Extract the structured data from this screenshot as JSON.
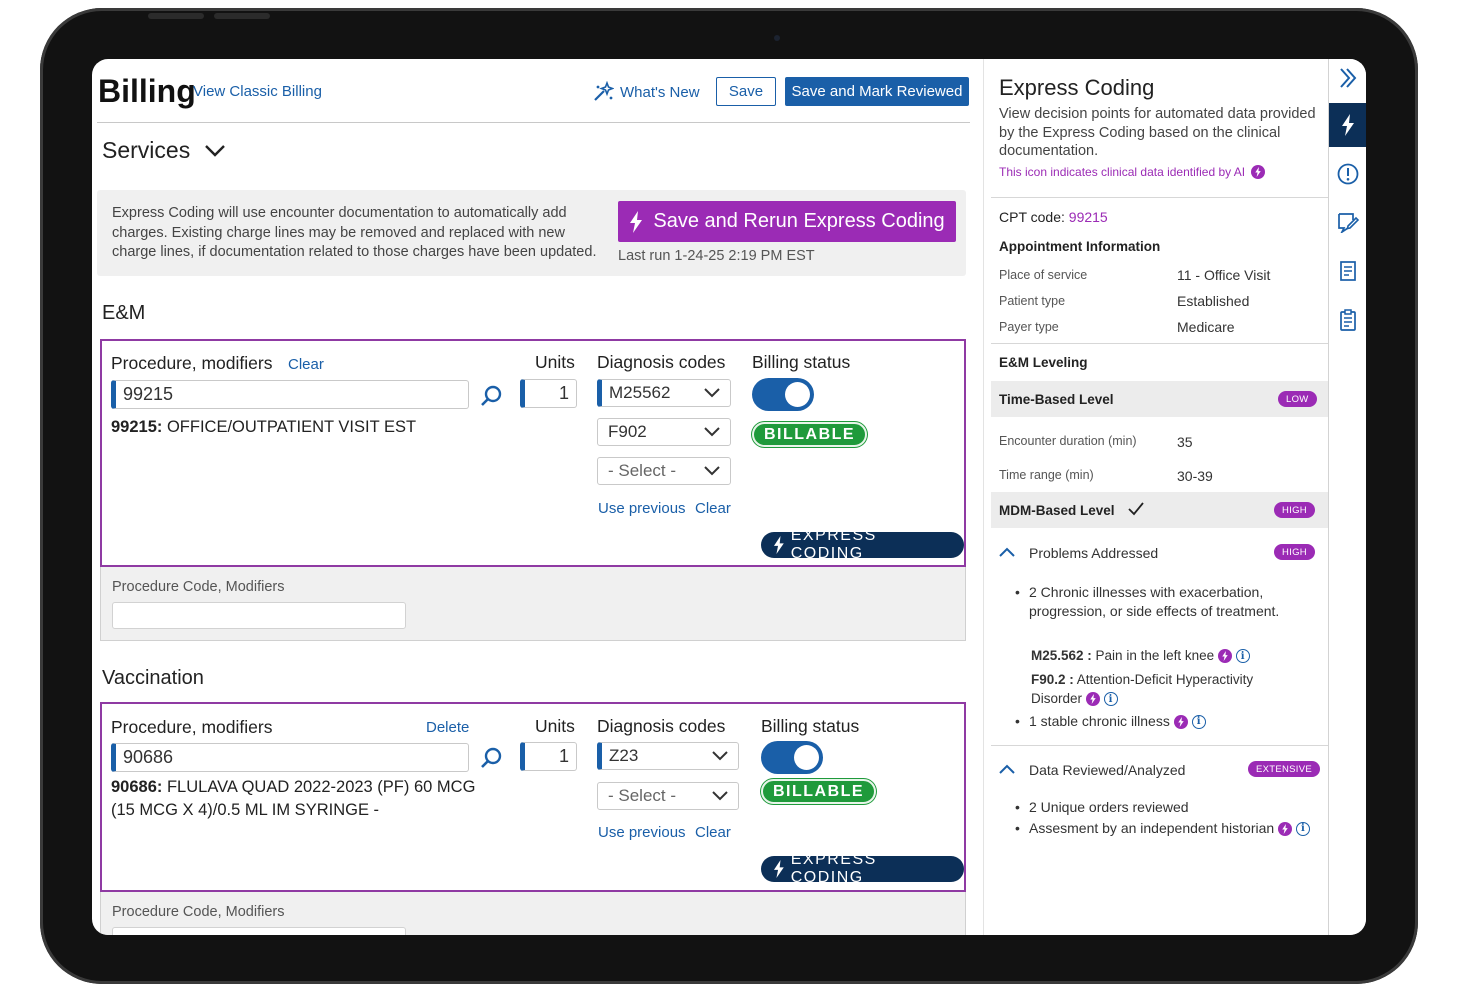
{
  "header": {
    "title": "Billing",
    "classic_link": "View Classic Billing",
    "whats_new": "What's New",
    "save": "Save",
    "save_mark": "Save and Mark Reviewed"
  },
  "services": {
    "title": "Services",
    "info": "Express Coding will use encounter documentation to automatically add charges. Existing charge lines may be removed and replaced with new charge lines, if documentation related to those charges have been updated.",
    "rerun_button": "Save and Rerun Express Coding",
    "last_run": "Last run 1-24-25 2:19 PM EST"
  },
  "em": {
    "section": "E&M",
    "proc_label": "Procedure, modifiers",
    "clear": "Clear",
    "units_label": "Units",
    "dx_label": "Diagnosis codes",
    "status_label": "Billing status",
    "code": "99215",
    "units": "1",
    "desc_code": "99215:",
    "desc_text": " OFFICE/OUTPATIENT VISIT EST",
    "dx": [
      "M25562",
      "F902",
      "- Select -"
    ],
    "use_previous": "Use previous",
    "dx_clear": "Clear",
    "billable": "BILLABLE",
    "express": "EXPRESS CODING",
    "sub_label": "Procedure Code, Modifiers"
  },
  "vacc": {
    "section": "Vaccination",
    "proc_label": "Procedure, modifiers",
    "delete": "Delete",
    "units_label": "Units",
    "dx_label": "Diagnosis codes",
    "status_label": "Billing status",
    "code": "90686",
    "units": "1",
    "desc_code": "90686:",
    "desc_text": " FLULAVA QUAD 2022-2023 (PF) 60 MCG (15 MCG X 4)/0.5 ML IM SYRINGE -",
    "dx": [
      "Z23",
      "- Select -"
    ],
    "use_previous": "Use previous",
    "dx_clear": "Clear",
    "billable": "BILLABLE",
    "express": "EXPRESS CODING",
    "sub_label": "Procedure Code, Modifiers"
  },
  "panel": {
    "title": "Express Coding",
    "desc": "View decision points for automated data provided by the Express Coding based on the clinical documentation.",
    "ai_note": "This icon indicates clinical data identified by AI",
    "cpt_label": "CPT code:",
    "cpt_value": "99215",
    "appt_title": "Appointment Information",
    "appt": [
      {
        "k": "Place of service",
        "v": "11 - Office Visit"
      },
      {
        "k": "Patient type",
        "v": "Established"
      },
      {
        "k": "Payer type",
        "v": "Medicare"
      }
    ],
    "em_leveling": "E&M Leveling",
    "time_level": "Time-Based Level",
    "time_badge": "LOW",
    "enc_label": "Encounter duration (min)",
    "enc_value": "35",
    "range_label": "Time range (min)",
    "range_value": "30-39",
    "mdm_level": "MDM-Based Level",
    "mdm_badge": "HIGH",
    "problems": "Problems Addressed",
    "problems_badge": "HIGH",
    "prob_b1": "2 Chronic illnesses with exacerbation, progression, or side effects of treatment.",
    "dx1_code": "M25.562 :",
    "dx1_text": " Pain in the left knee",
    "dx2_code": "F90.2 :",
    "dx2_text": " Attention-Deficit Hyperactivity Disorder",
    "prob_b2": "1 stable chronic illness",
    "data_reviewed": "Data Reviewed/Analyzed",
    "data_badge": "EXTENSIVE",
    "data_b1": "2 Unique orders reviewed",
    "data_b2": "Assesment by an independent historian"
  },
  "rail": {
    "icons": [
      "double-chevron-right-icon",
      "lightning-icon",
      "alert-circle-icon",
      "edit-note-icon",
      "document-icon",
      "clipboard-icon"
    ]
  },
  "colors": {
    "brand_blue": "#1a5fa8",
    "purple": "#9b2bb5",
    "navy": "#0c2f57",
    "green": "#1f9a3b"
  }
}
